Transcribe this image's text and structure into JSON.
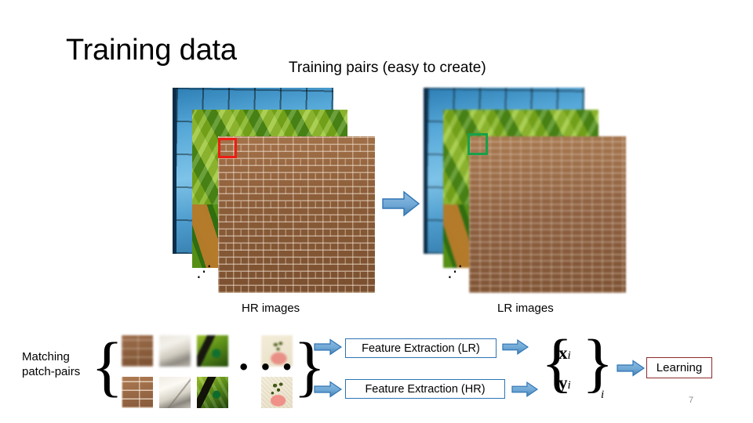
{
  "slide": {
    "title": "Training data",
    "subtitle": "Training pairs (easy to create)",
    "number": "7"
  },
  "stacks": {
    "hr": {
      "caption": "HR images",
      "ellipsis": "⋰",
      "marker_color": "#ee1c14",
      "layers": [
        "blue-glass-facade",
        "toucan-foliage",
        "brick-wall-sharp"
      ]
    },
    "lr": {
      "caption": "LR images",
      "ellipsis": "⋰",
      "marker_color": "#17a04a",
      "layers": [
        "blue-glass-facade",
        "toucan-foliage",
        "brick-wall-blurred"
      ]
    }
  },
  "bottom": {
    "matching_label_line1": "Matching",
    "matching_label_line2": "patch-pairs",
    "brace_open": "{",
    "brace_close": "}",
    "patch_ellipsis": "•  •  •",
    "patches": {
      "lr_row": [
        "brick-patch-lr",
        "white-object-patch-lr",
        "parrot-patch-lr",
        "flower-patch-lr"
      ],
      "hr_row": [
        "brick-patch-hr",
        "white-object-patch-hr",
        "parrot-patch-hr",
        "flower-patch-hr"
      ]
    },
    "feature_extraction_lr": "Feature Extraction (LR)",
    "feature_extraction_hr": "Feature Extraction (HR)",
    "pairs_math": {
      "open": "{",
      "close": "}",
      "x": "x",
      "x_sub": "i",
      "y": "y",
      "y_sub": "i",
      "outer_sub": "i"
    },
    "learning": "Learning"
  },
  "colors": {
    "arrow_fill": "#6fa8d6",
    "arrow_stroke": "#2e74b5",
    "fe_box_border": "#2e74b5",
    "learning_box_border": "#8c2b2b",
    "slide_number": "#8d8d8d"
  }
}
